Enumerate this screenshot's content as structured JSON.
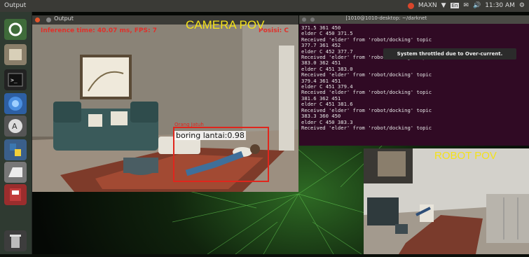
{
  "topbar": {
    "app_name": "Output",
    "network": "MAXN",
    "clock": "11:30 AM"
  },
  "launcher": {
    "items": [
      "dash-icon",
      "files-icon",
      "terminal-icon",
      "browser-icon",
      "software-icon",
      "python-icon",
      "drive-icon",
      "system-icon",
      "trash-icon"
    ]
  },
  "camera_window": {
    "title": "Output",
    "inference_text": "Inference time: 40.07 ms, FPS: 7",
    "position_text": "Posisi: C",
    "detection_tag": "Orang Jatuh",
    "detection_label": "boring lantai:0.98"
  },
  "terminal": {
    "title": "[1010@1010-desktop: ~/darknet",
    "lines": [
      "371.5 361 450",
      "elder C 450 371.5",
      "Received 'elder' from 'robot/docking' topic",
      "377.7 361 452",
      "elder C 452 377.7",
      "Received 'elder' from 'robot/docking' topic",
      "383.0 362 451",
      "elder C 451 383.0",
      "Received 'elder' from 'robot/docking' topic",
      "379.4 361 451",
      "elder C 451 379.4",
      "Received 'elder' from 'robot/docking' topic",
      "381.6 362 451",
      "elder C 451 381.6",
      "Received 'elder' from 'robot/docking' topic",
      "383.3 360 450",
      "elder C 450 383.3",
      "Received 'elder' from 'robot/docking' topic"
    ],
    "toast": "System throttled due to Over-current."
  },
  "labels": {
    "camera_pov": "CAMERA POV",
    "robot_pov": "ROBOT POV"
  },
  "colors": {
    "label_yellow": "#f4e21a",
    "detection_red": "#e0261d",
    "terminal_bg": "#300a24"
  }
}
